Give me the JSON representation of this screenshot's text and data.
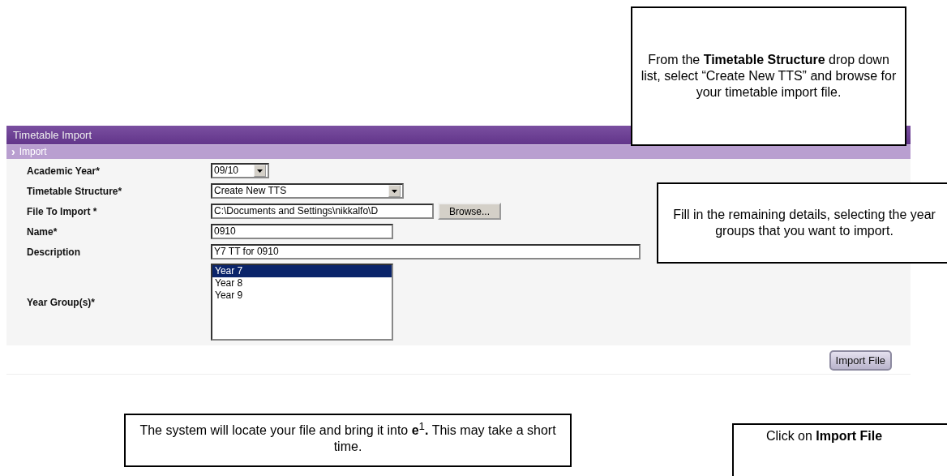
{
  "window": {
    "title": "Timetable Import"
  },
  "section": {
    "label": "Import",
    "icon": "›"
  },
  "form": [
    {
      "label": "Academic Year*",
      "kind": "select",
      "value": "09/10"
    },
    {
      "label": "Timetable Structure*",
      "kind": "select",
      "value": "Create New TTS"
    },
    {
      "label": "File To Import *",
      "kind": "file",
      "value": "C:\\Documents and Settings\\nikkalfo\\D",
      "button": "Browse..."
    },
    {
      "label": "Name*",
      "kind": "text",
      "value": "0910"
    },
    {
      "label": "Description",
      "kind": "text",
      "value": "Y7 TT for 0910"
    },
    {
      "label": "Year Group(s)*",
      "kind": "listbox",
      "options": [
        {
          "label": "Year 7",
          "selected": true
        },
        {
          "label": "Year 8",
          "selected": false
        },
        {
          "label": "Year 9",
          "selected": false
        }
      ]
    }
  ],
  "submit_button": "Import File",
  "callouts": [
    {
      "text": "From the **Timetable Structure** drop down list, select “Create New TTS” and browse for your timetable import file."
    },
    {
      "text": "Fill in the remaining details, selecting the year groups that you want to import."
    },
    {
      "text": "The system will locate your file and bring it into **e**$^{1}$**.** This may take a short time."
    },
    {
      "text": "Click on **Import File**"
    }
  ]
}
